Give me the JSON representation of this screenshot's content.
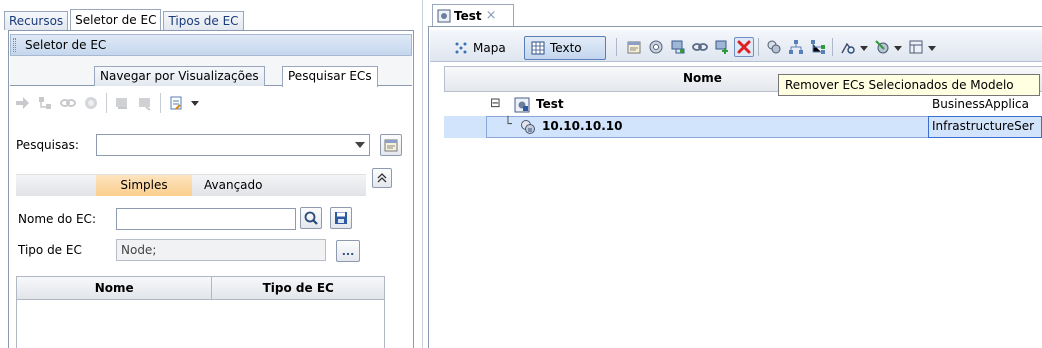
{
  "left_pane": {
    "tabs": [
      {
        "label": "Recursos",
        "active": false
      },
      {
        "label": "Seletor de EC",
        "active": true
      },
      {
        "label": "Tipos de EC",
        "active": false
      }
    ],
    "panel_title": "Seletor de EC",
    "sub_tabs": [
      {
        "label": "Navegar por Visualizações",
        "active": false
      },
      {
        "label": "Pesquisar ECs",
        "active": true
      }
    ],
    "toolbar_icons": [
      "arrow-right-icon",
      "tree-icon",
      "link-icon",
      "cube-icon",
      "ci-add-icon",
      "ci-remove-icon",
      "export-icon",
      "dropdown-arrow-icon"
    ],
    "pesquisas_label": "Pesquisas:",
    "pesquisas_value": "",
    "mode_tabs": {
      "simples": "Simples",
      "avancado": "Avançado",
      "active": "Simples"
    },
    "nome_label": "Nome do EC:",
    "nome_value": "",
    "tipo_label": "Tipo de EC",
    "tipo_value": "Node;",
    "browse_button": "...",
    "grid_columns": [
      "Nome",
      "Tipo de EC"
    ]
  },
  "right_pane": {
    "tab": {
      "title": "Test",
      "close": "×"
    },
    "view_buttons": {
      "mapa": "Mapa",
      "texto": "Texto",
      "active": "Texto"
    },
    "toolbar_icons": [
      "properties-icon",
      "cube-icon",
      "ci-relations-icon",
      "link-icon",
      "add-ci-icon",
      "delete-icon",
      "ci-type-icon",
      "hierarchy-icon",
      "hierarchy-alt-icon",
      "search-icon",
      "filter-icon",
      "layout-icon"
    ],
    "column_header": "Nome",
    "tooltip": "Remover ECs Selecionados de Modelo",
    "rows": [
      {
        "expander": "⊟",
        "name": "Test",
        "type": "BusinessApplica",
        "selected": false
      },
      {
        "expander": "└",
        "name": "10.10.10.10",
        "type": "InfrastructureSer",
        "selected": true
      }
    ]
  },
  "colors": {
    "accent": "#c5d7ee",
    "selection": "#d2e4fb",
    "active_mode": "#fbcf8d",
    "tooltip_bg": "#ffffe1",
    "delete_red": "#e02020"
  }
}
